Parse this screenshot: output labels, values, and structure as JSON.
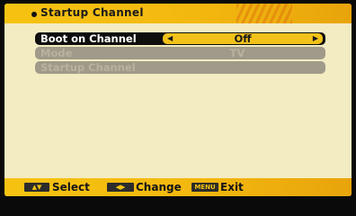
{
  "header": {
    "title": "Startup Channel"
  },
  "menu": {
    "rows": [
      {
        "label": "Boot on Channel",
        "value": "Off"
      },
      {
        "label": "Mode",
        "value": "TV"
      },
      {
        "label": "Startup Channel",
        "value": ""
      }
    ]
  },
  "footer": {
    "select_label": "Select",
    "change_label": "Change",
    "exit_label": "Exit",
    "menu_key": "MENU"
  },
  "icons": {
    "select_key": "up-down-arrows-icon",
    "change_key": "left-right-arrows-icon",
    "header_bullet": "bullet-icon"
  },
  "colors": {
    "background": "#f3ebc2",
    "accent": "#f6c312",
    "selected_row": "#0e0e0e",
    "disabled_row": "#9f9a89"
  }
}
